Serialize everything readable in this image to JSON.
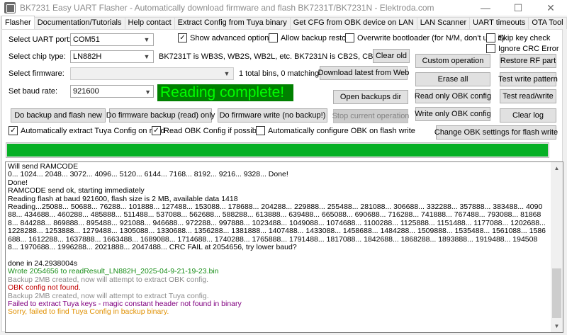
{
  "window": {
    "title": "BK7231 Easy UART Flasher - Automatically download firmware and flash BK7231T/BK7231N - Elektroda.com",
    "min_glyph": "—",
    "max_glyph": "☐",
    "close_glyph": "✕"
  },
  "tabs": [
    {
      "label": "Flasher",
      "active": true
    },
    {
      "label": "Documentation/Tutorials"
    },
    {
      "label": "Help contact"
    },
    {
      "label": "Extract Config from Tuya binary"
    },
    {
      "label": "Get CFG from OBK device on LAN"
    },
    {
      "label": "LAN Scanner"
    },
    {
      "label": "UART timeouts"
    },
    {
      "label": "OTA Tool"
    }
  ],
  "form": {
    "uart_label": "Select UART port:",
    "uart_value": "COM51",
    "chip_label": "Select chip type:",
    "chip_value": "LN882H",
    "chip_info": "BK7231T is WB3S, WB2S, WB2L, etc. BK7231N is CB2S, CB3S, etc",
    "firmware_label": "Select firmware:",
    "firmware_value": "",
    "firmware_info": "1 total bins, 0 matching.",
    "baud_label": "Set baud rate:",
    "baud_value": "921600",
    "status_text": "Reading complete!"
  },
  "checkboxes": {
    "show_advanced": {
      "label": "Show advanced options",
      "checked": true
    },
    "allow_backup_restore": {
      "label": "Allow backup restore",
      "checked": false
    },
    "overwrite_bootloader": {
      "label": "Overwrite bootloader (for N/M, don't use it)",
      "checked": false
    },
    "skip_key_check": {
      "label": "Skip key check",
      "checked": false
    },
    "ignore_crc": {
      "label": "Ignore CRC Error",
      "checked": false
    },
    "auto_extract_tuya": {
      "label": "Automatically extract Tuya Config on read",
      "checked": true
    },
    "read_obk_config": {
      "label": "Read OBK Config if possible",
      "checked": true
    },
    "auto_configure_obk": {
      "label": "Automatically configure OBK on flash write",
      "checked": false
    }
  },
  "check_glyph": "✓",
  "buttons": {
    "clear_old": "Clear old",
    "download_latest": "Download latest from Web",
    "open_backups": "Open backups dir",
    "stop_operation": "Stop current operation",
    "backup_and_flash": "Do backup and flash new",
    "firmware_backup": "Do firmware backup (read) only",
    "firmware_write": "Do firmware write (no backup!)",
    "custom_operation": "Custom operation",
    "restore_rf": "Restore RF part",
    "erase_all": "Erase all",
    "test_write_pattern": "Test write pattern",
    "read_only_obk": "Read only OBK config",
    "test_read_write": "Test read/write",
    "write_only_obk": "Write only OBK config",
    "clear_log": "Clear log",
    "change_obk_settings": "Change OBK settings for flash write"
  },
  "progress": {
    "value": 100
  },
  "log": [
    {
      "text": "Will send RAMCODE",
      "color": "#000000"
    },
    {
      "text": "0... 1024... 2048... 3072... 4096... 5120... 6144... 7168... 8192... 9216... 9328... Done!",
      "color": "#000000"
    },
    {
      "text": "Done!",
      "color": "#000000"
    },
    {
      "text": "RAMCODE send ok, starting immediately",
      "color": "#000000"
    },
    {
      "text": "Reading flash at baud 921600, flash size is 2 MB, available data 1418",
      "color": "#000000"
    },
    {
      "text": "Reading...25088... 50688... 76288... 101888... 127488... 153088... 178688... 204288... 229888... 255488... 281088... 306688... 332288... 357888... 383488... 409088... 434688... 460288... 485888... 511488... 537088... 562688... 588288... 613888... 639488... 665088... 690688... 716288... 741888... 767488... 793088... 818688... 844288... 869888... 895488... 921088... 946688... 972288... 997888... 1023488... 1049088... 1074688... 1100288... 1125888... 1151488... 1177088... 1202688... 1228288... 1253888... 1279488... 1305088... 1330688... 1356288... 1381888... 1407488... 1433088... 1458688... 1484288... 1509888... 1535488... 1561088... 1586688... 1612288... 1637888... 1663488... 1689088... 1714688... 1740288... 1765888... 1791488... 1817088... 1842688... 1868288... 1893888... 1919488... 1945088... 1970688... 1996288... 2021888... 2047488... CRC FAIL at 2054656, try lower baud?",
      "color": "#000000"
    },
    {
      "text": " ",
      "color": "#000000"
    },
    {
      "text": "done in 24.2938004s",
      "color": "#000000"
    },
    {
      "text": "Wrote 2054656 to readResult_LN882H_2025-04-9-21-19-23.bin",
      "color": "#1a8f1a"
    },
    {
      "text": "Backup 2MB created, now will attempt to extract OBK config.",
      "color": "#8c8c8c"
    },
    {
      "text": "OBK config not found.",
      "color": "#c00000"
    },
    {
      "text": "Backup 2MB created, now will attempt to extract Tuya config.",
      "color": "#8c8c8c"
    },
    {
      "text": "Failed to extract Tuya keys - magic constant header not found in binary",
      "color": "#800080"
    },
    {
      "text": "Sorry, failed to find Tuya Config in backup binary.",
      "color": "#e09000"
    }
  ]
}
